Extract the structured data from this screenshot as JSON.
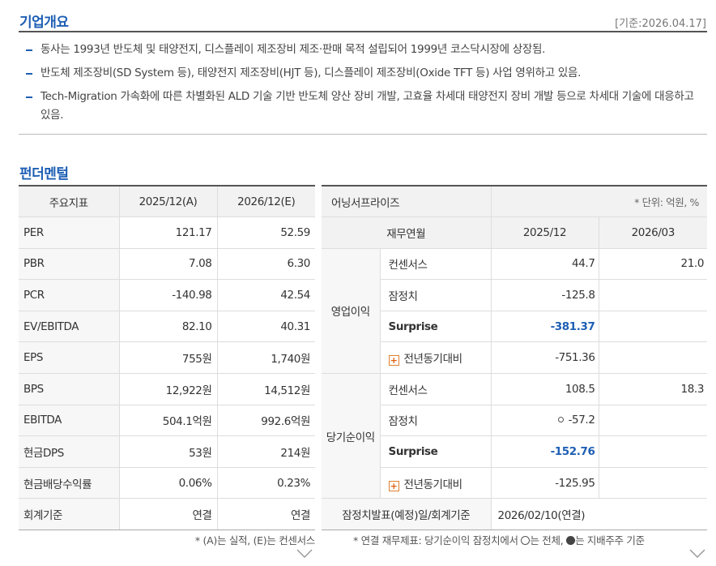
{
  "overview": {
    "title": "기업개요",
    "base_date": "[기준:2026.04.17]",
    "bullets": [
      "동사는 1993년 반도체 및 태양전지, 디스플레이 제조장비 제조·판매 목적 설립되어 1999년 코스닥시장에 상장됨.",
      "반도체 제조장비(SD System 등), 태양전지 제조장비(HJT 등), 디스플레이 제조장비(Oxide TFT 등) 사업 영위하고 있음.",
      "Tech-Migration 가속화에 따른 차별화된 ALD 기술 기반 반도체 양산 장비 개발, 고효율 차세대 태양전지 장비 개발 등으로 차세대 기술에 대응하고 있음."
    ]
  },
  "fundamental": {
    "title": "펀더멘털",
    "indicators": {
      "headers": [
        "주요지표",
        "2025/12(A)",
        "2026/12(E)"
      ],
      "rows": [
        {
          "label": "PER",
          "a": "121.17",
          "e": "52.59"
        },
        {
          "label": "PBR",
          "a": "7.08",
          "e": "6.30"
        },
        {
          "label": "PCR",
          "a": "-140.98",
          "e": "42.54"
        },
        {
          "label": "EV/EBITDA",
          "a": "82.10",
          "e": "40.31"
        },
        {
          "label": "EPS",
          "a": "755원",
          "e": "1,740원"
        },
        {
          "label": "BPS",
          "a": "12,922원",
          "e": "14,512원"
        },
        {
          "label": "EBITDA",
          "a": "504.1억원",
          "e": "992.6억원"
        },
        {
          "label": "현금DPS",
          "a": "53원",
          "e": "214원"
        },
        {
          "label": "현금배당수익률",
          "a": "0.06%",
          "e": "0.23%"
        },
        {
          "label": "회계기준",
          "a": "연결",
          "e": "연결"
        }
      ],
      "note": "* (A)는 실적, (E)는 컨센서스"
    },
    "earnings": {
      "title": "어닝서프라이즈",
      "unit": "* 단위: 억원, %",
      "headers": [
        "재무연월",
        "2025/12",
        "2026/03"
      ],
      "groups": [
        {
          "name": "영업이익",
          "rows": [
            {
              "label": "컨센서스",
              "v1": "44.7",
              "v2": "21.0"
            },
            {
              "label": "잠정치",
              "v1": "-125.8",
              "v2": ""
            },
            {
              "label": "Surprise",
              "v1": "-381.37",
              "v2": ""
            },
            {
              "label": "전년동기대비",
              "v1": "-751.36",
              "v2": ""
            }
          ]
        },
        {
          "name": "당기순이익",
          "rows": [
            {
              "label": "컨센서스",
              "v1": "108.5",
              "v2": "18.3"
            },
            {
              "label": "잠정치",
              "v1": "-57.2",
              "v2": ""
            },
            {
              "label": "Surprise",
              "v1": "-152.76",
              "v2": ""
            },
            {
              "label": "전년동기대비",
              "v1": "-125.95",
              "v2": ""
            }
          ]
        }
      ],
      "footer": {
        "label": "잠정치발표(예정)일/회계기준",
        "value": "2026/02/10(연결)"
      },
      "note_prefix": "* 연결 재무제표: 당기순이익 잠정치에서 ",
      "note_mid": "는 전체, ",
      "note_suffix": "는 지배주주 기준"
    }
  },
  "icons": {
    "expand": "chevron-down-icon",
    "plus": "plus-icon"
  },
  "colors": {
    "accent": "#1e5fb4",
    "surprise": "#1e5fb4"
  }
}
